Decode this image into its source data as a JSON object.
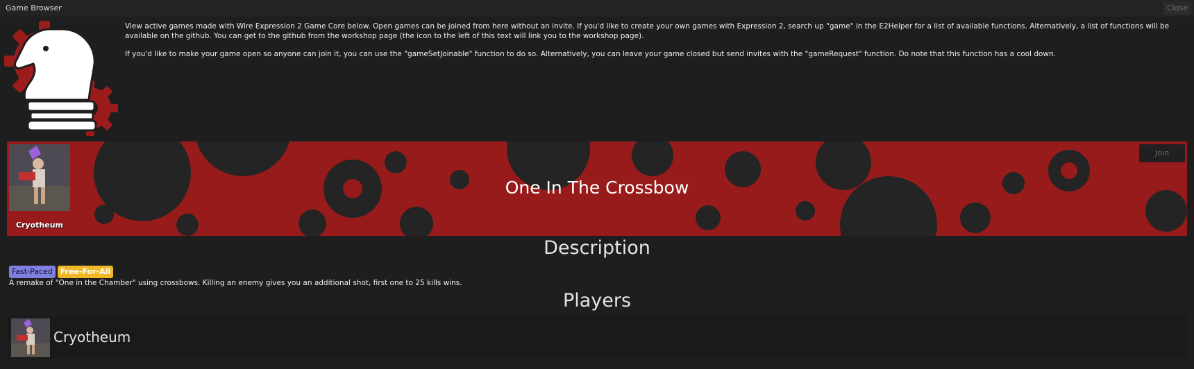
{
  "window": {
    "title": "Game Browser",
    "close_label": "Close"
  },
  "intro": {
    "paragraph1": "View active games made with Wire Expression 2 Game Core below. Open games can be joined from here without an invite. If you'd like to create your own games with Expression 2, search up \"game\" in the E2Helper for a list of available functions. Alternatively, a list of functions will be available on the github. You can get to the github from the workshop page (the icon to the left of this text will link you to the workshop page).",
    "paragraph2": "If you'd like to make your game open so anyone can join it, you can use the \"gameSetJoinable\" function to do so. Alternatively, you can leave your game closed but send invites with the \"gameRequest\" function. Do note that this function has a cool down."
  },
  "colors": {
    "banner_red": "#981b1b",
    "gear_dark": "#242424",
    "tag_fast": "#7f7fe0",
    "tag_ffa": "#f0b826"
  },
  "game": {
    "title": "One In The Crossbow",
    "host_name": "Cryotheum",
    "join_label": "Join",
    "description_heading": "Description",
    "tags": [
      "Fast-Paced",
      "Free-For-All"
    ],
    "description": "A remake of \"One in the Chamber\" using crossbows. Killing an enemy gives you an additional shot, first one to 25 kills wins.",
    "players_heading": "Players",
    "players": [
      {
        "name": "Cryotheum",
        "avatar": "player-avatar-icon"
      }
    ]
  }
}
